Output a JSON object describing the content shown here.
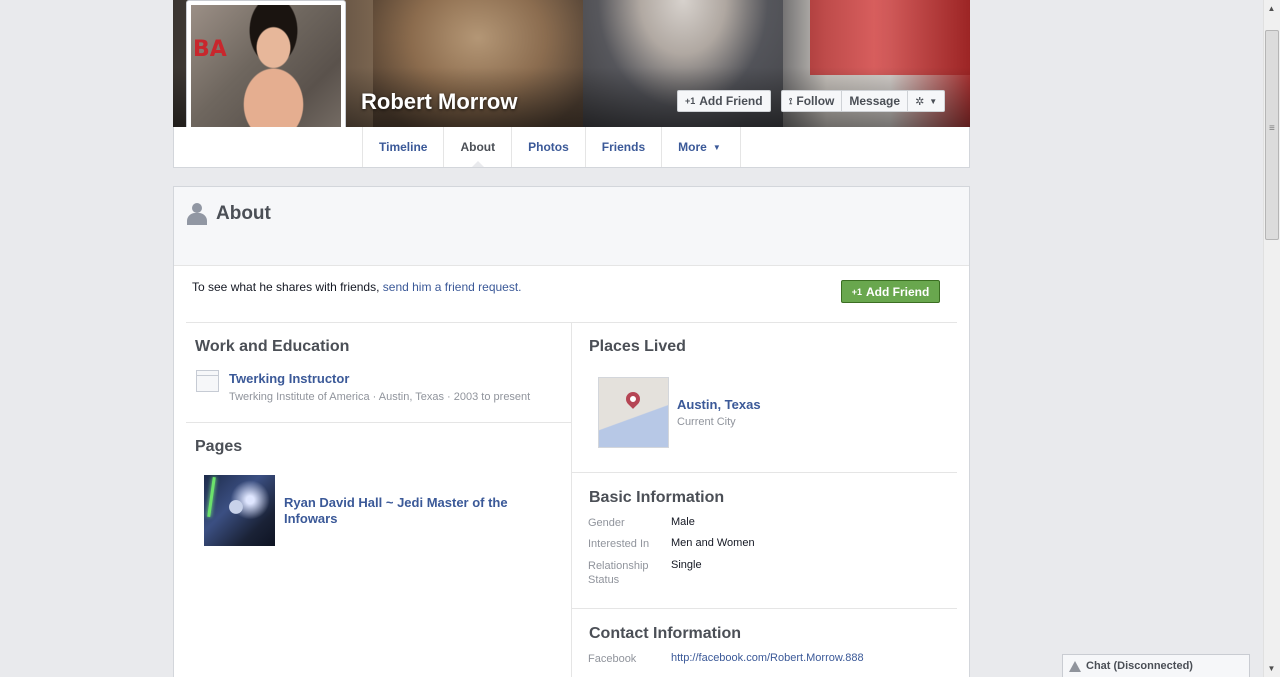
{
  "profile": {
    "name": "Robert Morrow",
    "cover_buttons": {
      "add_friend": "Add Friend",
      "follow": "Follow",
      "message": "Message"
    },
    "tabs": [
      {
        "label": "Timeline"
      },
      {
        "label": "About"
      },
      {
        "label": "Photos"
      },
      {
        "label": "Friends"
      },
      {
        "label": "More"
      }
    ]
  },
  "about": {
    "title": "About",
    "friend_request_text": "To see what he shares with friends, ",
    "friend_request_link": "send him a friend request.",
    "add_friend_button": "Add Friend",
    "work_education": {
      "title": "Work and Education",
      "job_title": "Twerking Instructor",
      "job_details": "Twerking Institute of America · Austin, Texas · 2003 to present"
    },
    "pages": {
      "title": "Pages",
      "items": [
        {
          "name": "Ryan David Hall ~ Jedi Master of the Infowars"
        }
      ]
    },
    "places_lived": {
      "title": "Places Lived",
      "city": "Austin, Texas",
      "city_label": "Current City"
    },
    "basic_info": {
      "title": "Basic Information",
      "rows": [
        {
          "label": "Gender",
          "value": "Male"
        },
        {
          "label": "Interested In",
          "value": "Men and Women"
        },
        {
          "label": "Relationship Status",
          "value": "Single"
        }
      ]
    },
    "contact_info": {
      "title": "Contact Information",
      "rows": [
        {
          "label": "Facebook",
          "value": "http://facebook.com/Robert.Morrow.888"
        }
      ]
    }
  },
  "chat": {
    "label": "Chat (Disconnected)"
  },
  "colors": {
    "link": "#3b5998",
    "add_friend_green": "#69a74e",
    "page_bg": "#e9eaed"
  }
}
